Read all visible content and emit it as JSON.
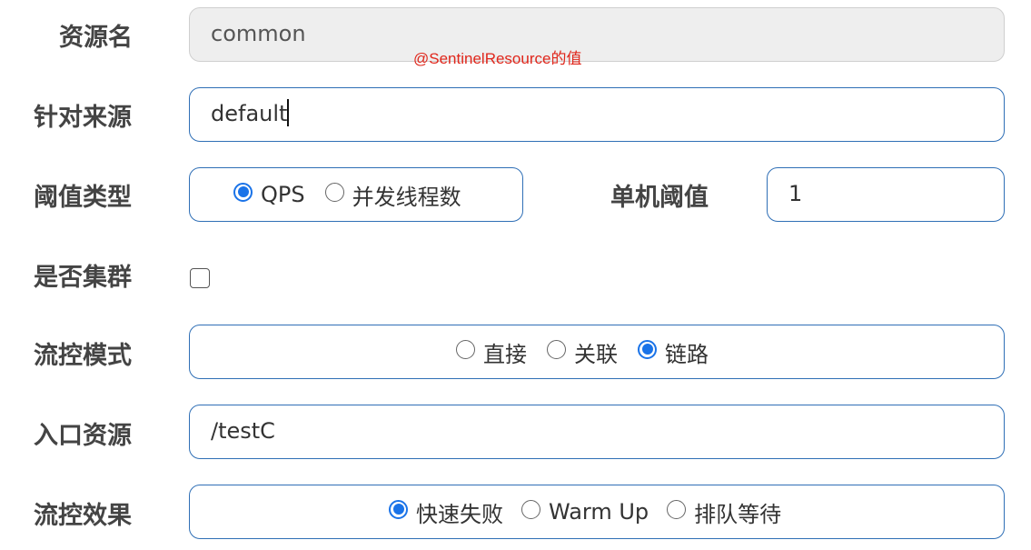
{
  "annotation": "@SentinelResource的值",
  "resource_name": {
    "label": "资源名",
    "value": "common"
  },
  "limit_app": {
    "label": "针对来源",
    "value": "default"
  },
  "threshold_type": {
    "label": "阈值类型",
    "options": [
      {
        "label": "QPS",
        "checked": true
      },
      {
        "label": "并发线程数",
        "checked": false
      }
    ]
  },
  "single_threshold": {
    "label": "单机阈值",
    "value": "1"
  },
  "cluster": {
    "label": "是否集群",
    "checked": false
  },
  "flow_mode": {
    "label": "流控模式",
    "options": [
      {
        "label": "直接",
        "checked": false
      },
      {
        "label": "关联",
        "checked": false
      },
      {
        "label": "链路",
        "checked": true
      }
    ]
  },
  "entry_resource": {
    "label": "入口资源",
    "value": "/testC"
  },
  "flow_effect": {
    "label": "流控效果",
    "options": [
      {
        "label": "快速失败",
        "checked": true
      },
      {
        "label": "Warm Up",
        "checked": false
      },
      {
        "label": "排队等待",
        "checked": false
      }
    ]
  },
  "colors": {
    "border": "#2f6fb6",
    "radio_accent": "#1a73e8",
    "annotation": "#e0261b",
    "disabled_bg": "#eeeeee"
  }
}
